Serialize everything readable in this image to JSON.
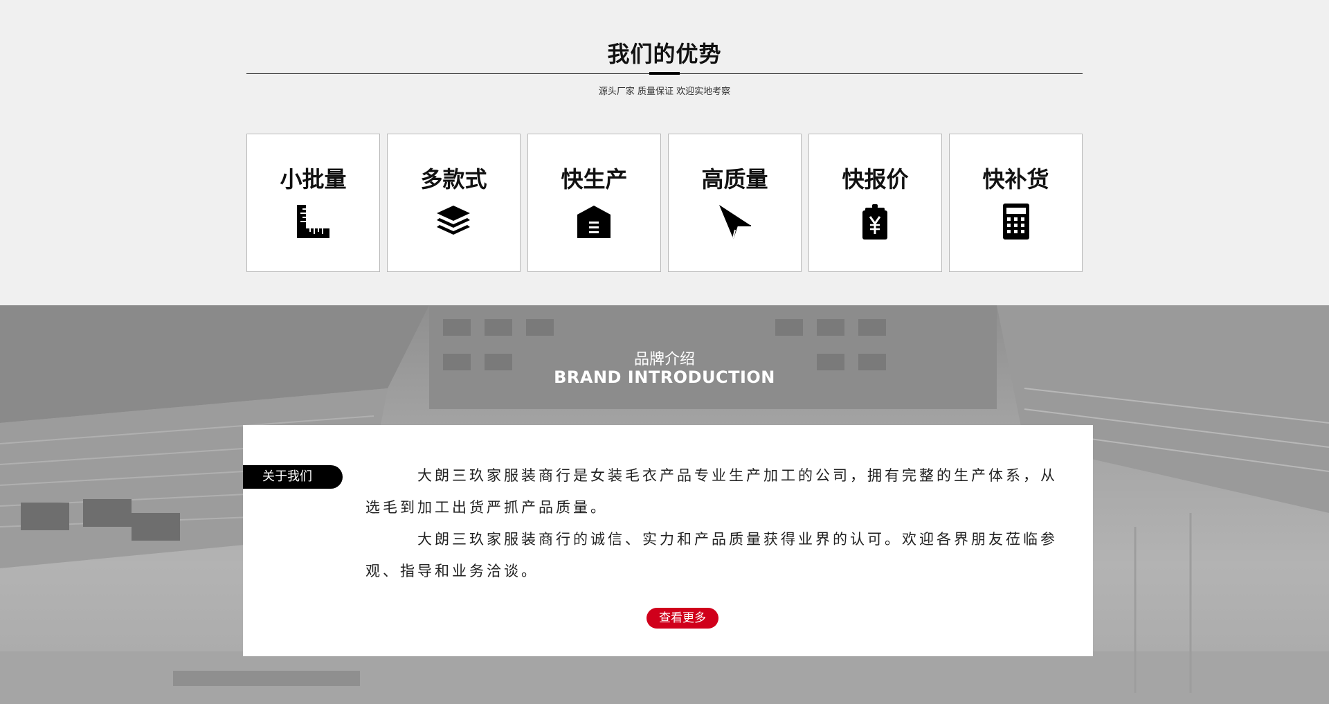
{
  "advantages": {
    "title": "我们的优势",
    "subtitle": "源头厂家 质量保证 欢迎实地考察",
    "items": [
      {
        "label": "小批量",
        "icon": "ruler-icon"
      },
      {
        "label": "多款式",
        "icon": "layers-icon"
      },
      {
        "label": "快生产",
        "icon": "warehouse-icon"
      },
      {
        "label": "高质量",
        "icon": "paper-plane-icon"
      },
      {
        "label": "快报价",
        "icon": "yen-tag-icon"
      },
      {
        "label": "快补货",
        "icon": "calculator-icon"
      }
    ]
  },
  "brand": {
    "title_cn": "品牌介绍",
    "title_en": "BRAND INTRODUCTION",
    "about_tag": "关于我们",
    "paragraphs": [
      "大朗三玖家服装商行是女装毛衣产品专业生产加工的公司，拥有完整的生产体系，从选毛到加工出货严抓产品质量。",
      "大朗三玖家服装商行的诚信、实力和产品质量获得业界的认可。欢迎各界朋友莅临参观、指导和业务洽谈。"
    ],
    "more_button": "查看更多"
  },
  "colors": {
    "accent_red": "#d0001b",
    "panel_bg": "#ffffff",
    "section_bg": "#f0f0f0"
  }
}
